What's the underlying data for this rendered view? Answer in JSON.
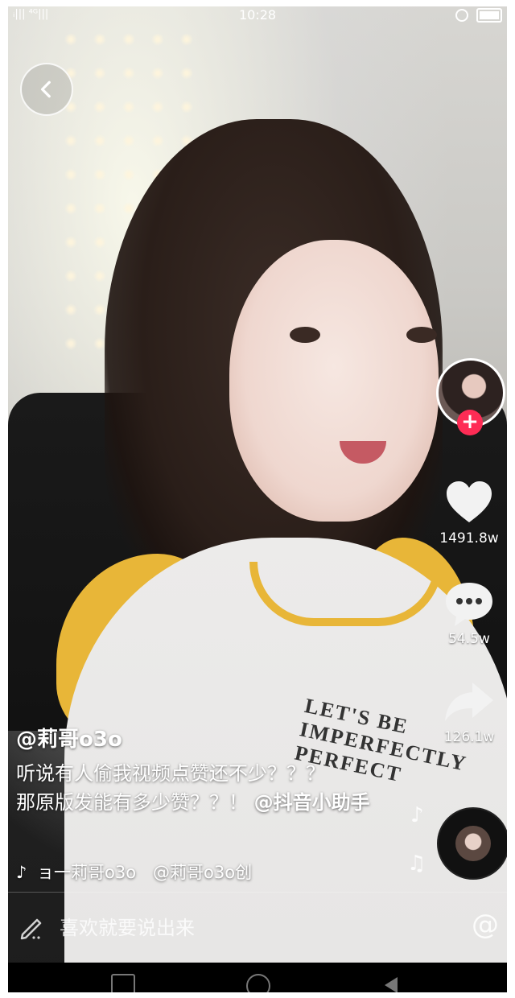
{
  "status_bar": {
    "left": "ᵢ||| ⁴ᴳ|||",
    "time": "10:28"
  },
  "author": {
    "username": "@莉哥o3o"
  },
  "caption": {
    "line1": "听说有人偷我视频点赞还不少？？？",
    "line2": "那原版发能有多少赞？？！",
    "mention": "@抖音小助手"
  },
  "music": {
    "text": "ョ一莉哥o3o　@莉哥o3o创"
  },
  "actions": {
    "likes": "1491.8w",
    "comments": "54.5w",
    "shares": "126.1w",
    "follow_symbol": "+"
  },
  "comment_bar": {
    "placeholder": "喜欢就要说出来",
    "at_symbol": "@"
  },
  "shirt_text": "LET'S BE IMPERFECTLY PERFECT"
}
